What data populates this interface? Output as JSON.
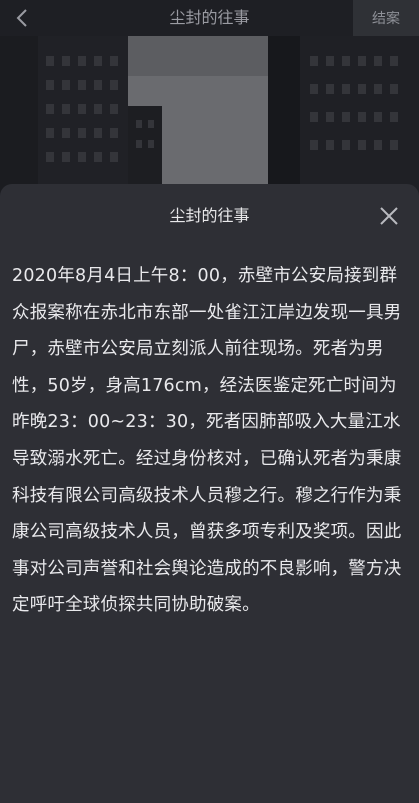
{
  "topbar": {
    "title": "尘封的往事",
    "back_icon": "chevron-left-icon",
    "close_case_label": "结案"
  },
  "sheet": {
    "title": "尘封的往事",
    "close_icon": "close-icon",
    "body": "2020年8月4日上午8：00，赤壁市公安局接到群众报案称在赤北市东部一处雀江江岸边发现一具男尸，赤壁市公安局立刻派人前往现场。死者为男性，50岁，身高176cm，经法医鉴定死亡时间为昨晚23：00~23：30，死者因肺部吸入大量江水导致溺水死亡。经过身份核对，已确认死者为秉康科技有限公司高级技术人员穆之行。穆之行作为秉康公司高级技术人员，曾获多项专利及奖项。因此事对公司声誉和社会舆论造成的不良影响，警方决定呼吁全球侦探共同协助破案。"
  },
  "colors": {
    "topbar_bg": "#1e1f24",
    "sheet_bg": "#2e2f35",
    "text_primary": "#e9e9ec",
    "text_muted": "#9a9ba2"
  }
}
